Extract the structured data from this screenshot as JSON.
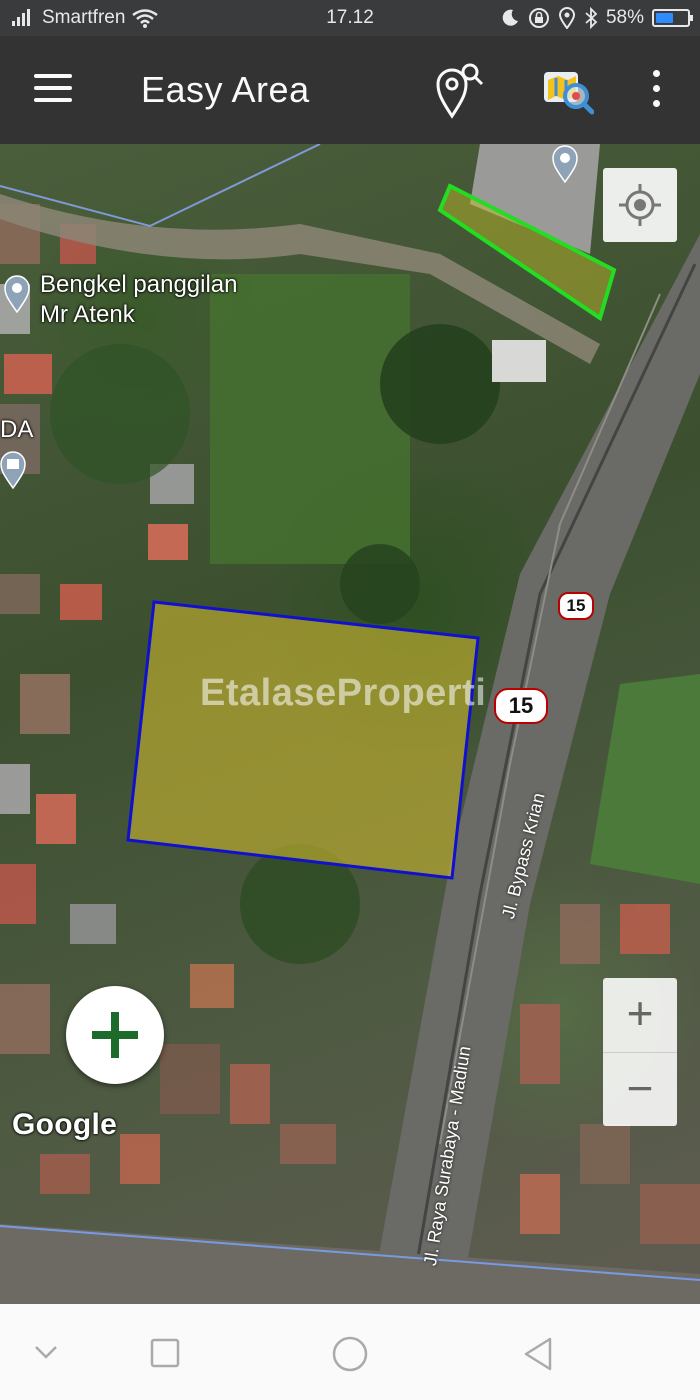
{
  "status_bar": {
    "carrier": "Smartfren",
    "time": "17.12",
    "battery": "58%",
    "battery_level": 0.58,
    "icons": [
      "signal-icon",
      "wifi-icon",
      "moon-icon",
      "lock-rotation-icon",
      "location-icon",
      "bluetooth-icon",
      "battery-icon"
    ]
  },
  "app_bar": {
    "title": "Easy Area",
    "icons": [
      "menu-icon",
      "location-search-icon",
      "map-search-icon",
      "more-vert-icon"
    ]
  },
  "map": {
    "poi_label": "Bengkel panggilan\nMr Atenk",
    "poi_partial_label": "DA",
    "road_label_1": "Jl. Bypass Krian",
    "road_label_2": "Jl. Raya Surabaya - Madiun",
    "route_shield_1": "15",
    "route_shield_2": "15",
    "watermark": "EtalaseProperti",
    "attribution": "Google",
    "polygon_colors": {
      "selected_fill": "#c8b530",
      "selected_stroke": "#1010d0",
      "other_stroke": "#22dd22"
    }
  },
  "controls": {
    "zoom_in": "+",
    "zoom_out": "−"
  },
  "nav_bar": {
    "icons": [
      "back-chevron-icon",
      "recents-square-icon",
      "home-circle-icon",
      "back-triangle-icon"
    ]
  }
}
